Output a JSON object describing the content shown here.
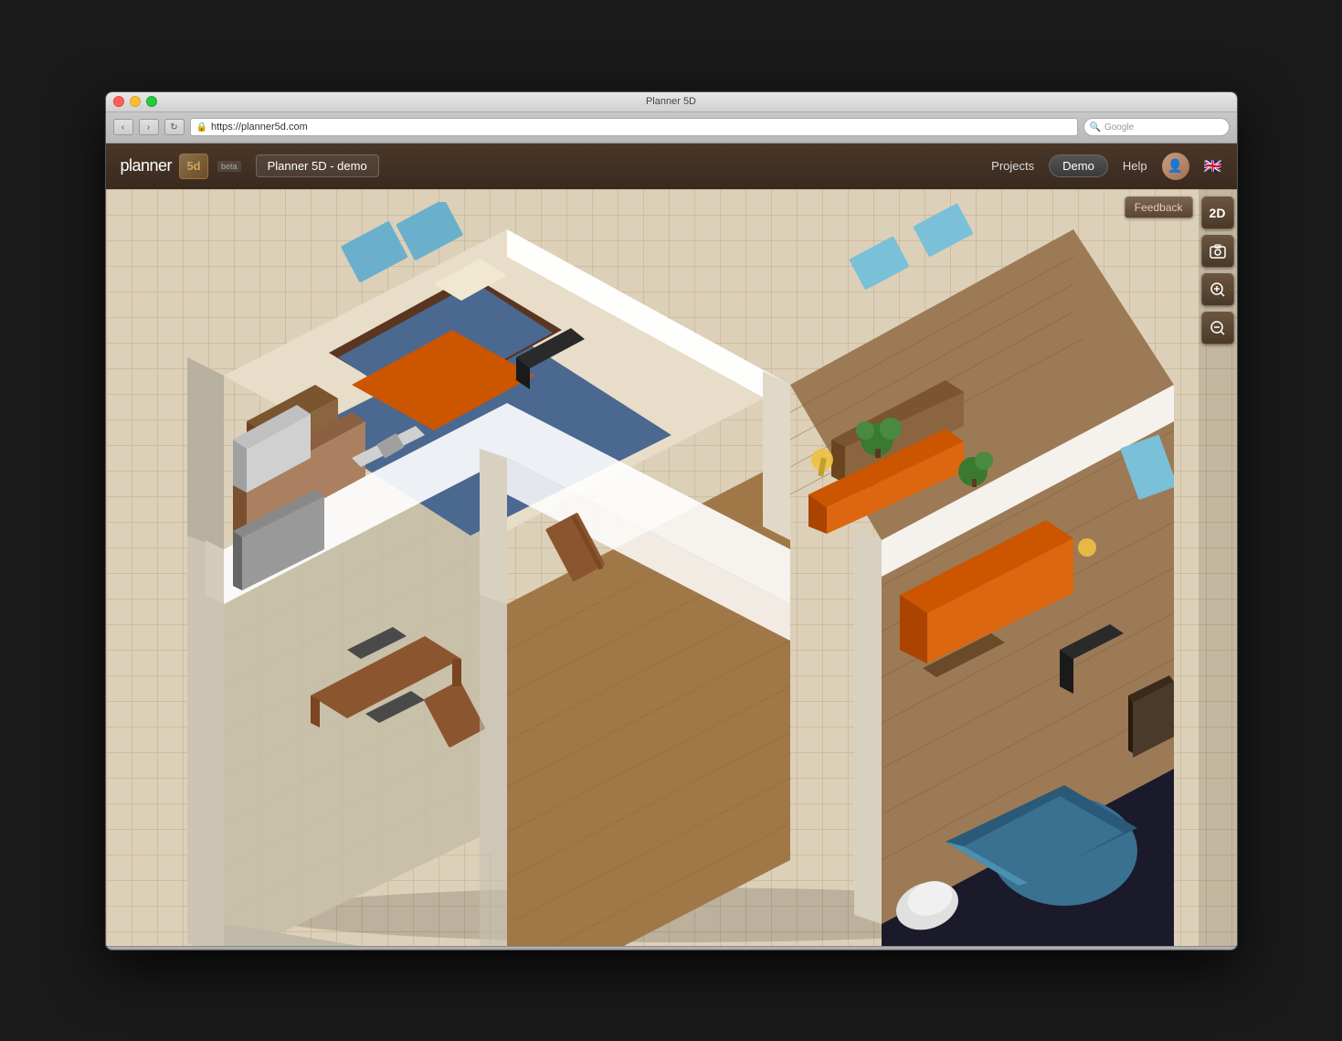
{
  "window": {
    "title": "Planner 5D",
    "buttons": {
      "close": "close",
      "minimize": "minimize",
      "maximize": "maximize"
    }
  },
  "browser": {
    "back_label": "‹",
    "forward_label": "›",
    "refresh_label": "↻",
    "url": "https://planner5d.com",
    "url_icon": "🔒",
    "search_placeholder": "Google"
  },
  "app_nav": {
    "logo_text": "planner",
    "logo_5d": "5d",
    "beta_label": "beta",
    "project_name": "Planner 5D - demo",
    "projects_label": "Projects",
    "demo_label": "Demo",
    "help_label": "Help"
  },
  "toolbar": {
    "feedback_label": "Feedback",
    "btn_2d": "2D",
    "btn_camera": "📷",
    "btn_zoom_in": "⊕",
    "btn_zoom_out": "⊖"
  },
  "colors": {
    "nav_bg": "#3a2a1e",
    "grid_bg": "#ddd0b8",
    "wall_color": "#e8e0d0",
    "floor_tile": "#c8c0a8",
    "wood_floor": "#8b6040",
    "orange_furniture": "#cc5500",
    "window_frame": "#cc6633",
    "blue_rug": "#4a6890",
    "bathroom_blue": "#4488aa"
  }
}
